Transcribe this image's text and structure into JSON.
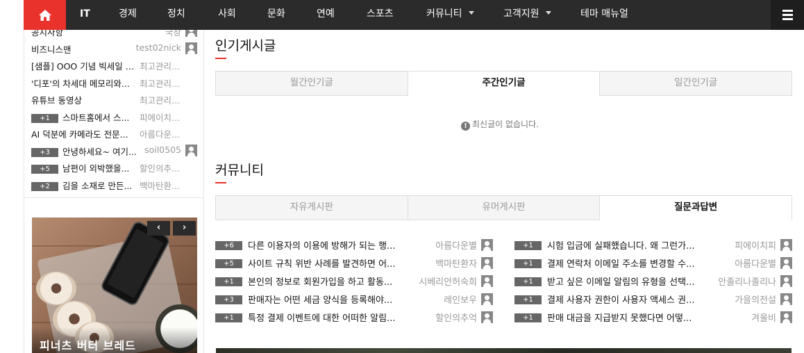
{
  "nav": {
    "items": [
      {
        "label": "IT",
        "bold": true
      },
      {
        "label": "경제"
      },
      {
        "label": "정치"
      },
      {
        "label": "사회"
      },
      {
        "label": "문화"
      },
      {
        "label": "연예"
      },
      {
        "label": "스포츠"
      },
      {
        "label": "커뮤니티",
        "dropdown": true
      },
      {
        "label": "고객지원",
        "dropdown": true
      },
      {
        "label": "테마 매뉴얼"
      }
    ],
    "home_icon": "home-icon",
    "menu_icon": "hamburger-menu-icon",
    "accent_color": "#e8322b"
  },
  "sidebar": {
    "posts": [
      {
        "badge": "",
        "title": "유튜브 동영상",
        "author": "최고관리자..."
      },
      {
        "badge": "+1",
        "title": "스마트홈에서 스...",
        "author": "피에이치피..."
      },
      {
        "badge": "",
        "title": "AI 덕분에 카메라도 전문...",
        "author": "아름다운별..."
      },
      {
        "badge": "+3",
        "title": "안녕하세요~ 여기...",
        "author": "soil0505"
      },
      {
        "badge": "+5",
        "title": "남편이 외박했을...",
        "author": "할인의추억..."
      },
      {
        "badge": "+2",
        "title": "김을 소재로 만든...",
        "author": "백마탄환자..."
      }
    ],
    "top_posts": [
      {
        "title": "공지사항",
        "author": "국장"
      },
      {
        "title": "비즈니스맨",
        "author": "test02nick"
      },
      {
        "title": "[샘플] OOO 기념 빅세일 쿠...",
        "author": "최고관리자..."
      },
      {
        "title": "'디포'의 차세대 메모리와...",
        "author": "최고관리자..."
      }
    ],
    "slide": {
      "caption": "피너츠 버터 브레드",
      "prev": "‹",
      "next": "›"
    }
  },
  "popular": {
    "title": "인기게시글",
    "tabs": [
      "월간인기글",
      "주간인기글",
      "일간인기글"
    ],
    "active_tab": 1,
    "empty_message": "최신글이 없습니다."
  },
  "community": {
    "title": "커뮤니티",
    "tabs": [
      "자유게시판",
      "유머게시판",
      "질문과답변"
    ],
    "active_tab": 2,
    "left_posts": [
      {
        "badge": "+6",
        "title": "다른 이용자의 이용에 방해가 되는 행...",
        "author": "아름다운별"
      },
      {
        "badge": "+5",
        "title": "사이트 규칙 위반 사례를 발견하면 어...",
        "author": "백마탄환자"
      },
      {
        "badge": "+1",
        "title": "본인의 정보로 회원가입을 하고 활동...",
        "author": "시베리안허숙희"
      },
      {
        "badge": "+3",
        "title": "판매자는 어떤 세금 양식을 등록해야...",
        "author": "레인보우"
      },
      {
        "badge": "+1",
        "title": "특정 결제 이벤트에 대한 어떠한 알림...",
        "author": "할인의추억"
      }
    ],
    "right_posts": [
      {
        "badge": "+1",
        "title": "시험 입금에 실패했습니다. 왜 그런가...",
        "author": "피에이치피"
      },
      {
        "badge": "+1",
        "title": "결제 연락처 이메일 주소를 변경할 수...",
        "author": "아름다운별"
      },
      {
        "badge": "+1",
        "title": "받고 싶은 이메일 알림의 유형을 선택...",
        "author": "안졸리나졸리나"
      },
      {
        "badge": "+1",
        "title": "결제 사용자 권한이 사용자 액세스 권...",
        "author": "가을의전설"
      },
      {
        "badge": "+1",
        "title": "판매 대금을 지급받지 못했다면 어떻...",
        "author": "겨울비"
      }
    ]
  }
}
